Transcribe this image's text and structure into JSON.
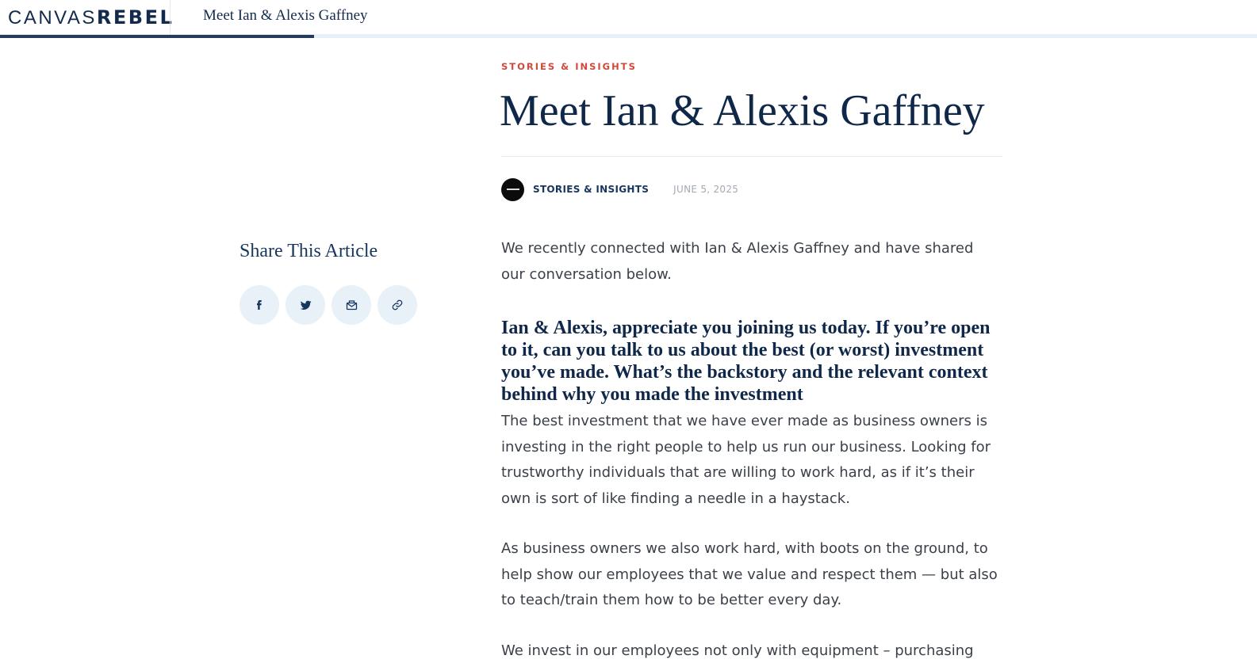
{
  "header": {
    "logo_light": "CANVAS",
    "logo_bold": "REBEL",
    "title": "Meet Ian & Alexis Gaffney",
    "progress": 0.25
  },
  "article": {
    "eyebrow": "STORIES & INSIGHTS",
    "headline": "Meet Ian & Alexis Gaffney",
    "meta": {
      "category": "STORIES & INSIGHTS",
      "date": "JUNE 5, 2025"
    },
    "intro": "We recently connected with Ian & Alexis Gaffney and have shared our conversation below.",
    "question": "Ian & Alexis, appreciate you joining us today. If you’re open to it, can you talk to us about the best (or worst) investment you’ve made. What’s the backstory and the relevant context behind why you made the investment",
    "answer_1": "The best investment that we have ever made as business owners is investing in the right people to help us run our business. Looking for trustworthy individuals that are willing to work hard, as if it’s their own is sort of like finding a needle in a haystack.",
    "answer_2": "As business owners we also work hard, with boots on the ground, to help show our employees that we value and respect them — but also to teach/train them how to be better every day.",
    "answer_3": "We invest in our employees not only with equipment – purchasing items"
  },
  "share": {
    "title": "Share This Article",
    "buttons": [
      {
        "icon": "facebook-icon"
      },
      {
        "icon": "twitter-icon"
      },
      {
        "icon": "email-icon"
      },
      {
        "icon": "link-icon"
      }
    ]
  },
  "colors": {
    "navy": "#0f2748",
    "accent": "#d2483c",
    "share_bg": "#e8f0f8"
  }
}
